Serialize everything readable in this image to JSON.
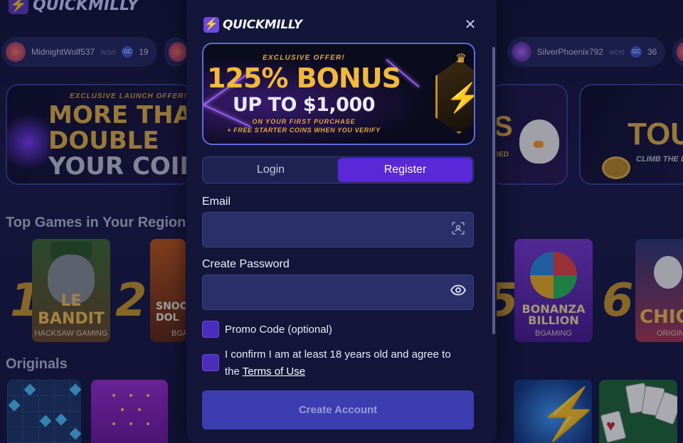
{
  "background": {
    "logo_text": "QUICKMILLY",
    "ticker": [
      {
        "user": "MidnightWolf537",
        "won": "won",
        "amount": "19",
        "currency": "GC"
      },
      {
        "user": "SilverPhoenix792",
        "won": "won",
        "amount": "36",
        "currency": "GC"
      }
    ],
    "promo_cards": [
      {
        "kicker": "EXCLUSIVE LAUNCH OFFER!",
        "line1": "MORE THAN",
        "line2": "DOUBLE",
        "line3": "YOUR COINS"
      },
      {
        "text": "S",
        "sub": "DED"
      },
      {
        "text": "TOUR",
        "sub": "CLIMB THE L"
      }
    ],
    "section_top_games": "Top Games in Your Region",
    "section_originals": "Originals",
    "top_games": [
      {
        "rank": "1",
        "name": "LE BANDIT",
        "provider": "HACKSAW GAMING"
      },
      {
        "rank": "2",
        "name": "SNOO DOL",
        "provider": "BGA"
      },
      {
        "rank": "5",
        "name": "BONANZA BILLION",
        "provider": "BGAMING"
      },
      {
        "rank": "6",
        "name": "CHIC",
        "provider": "ORIGINA"
      }
    ]
  },
  "modal": {
    "logo_text": "QUICKMILLY",
    "close_glyph": "✕",
    "banner": {
      "kicker": "EXCLUSIVE OFFER!",
      "headline": "125% BONUS",
      "subhead": "UP TO $1,000",
      "fine1": "ON YOUR FIRST PURCHASE",
      "fine2": "+ FREE STARTER COINS WHEN YOU VERIFY"
    },
    "tabs": [
      {
        "label": "Login",
        "active": false
      },
      {
        "label": "Register",
        "active": true
      }
    ],
    "email": {
      "label": "Email",
      "value": "",
      "placeholder": "",
      "icon": "contact-card-icon"
    },
    "password": {
      "label": "Create Password",
      "value": "",
      "placeholder": "",
      "icon": "eye-icon"
    },
    "promo_checkbox": {
      "label": "Promo Code (optional)",
      "checked": false
    },
    "age_checkbox": {
      "label_line1": "I confirm I am at least 18 years old and agree to",
      "label_prefix": "the ",
      "link_text": "Terms of Use",
      "checked": false
    },
    "submit_label": "Create Account",
    "colors": {
      "accent": "#5a28d6",
      "button": "#3d3db2",
      "gold": "#f2b83c",
      "panel": "#131539"
    }
  }
}
